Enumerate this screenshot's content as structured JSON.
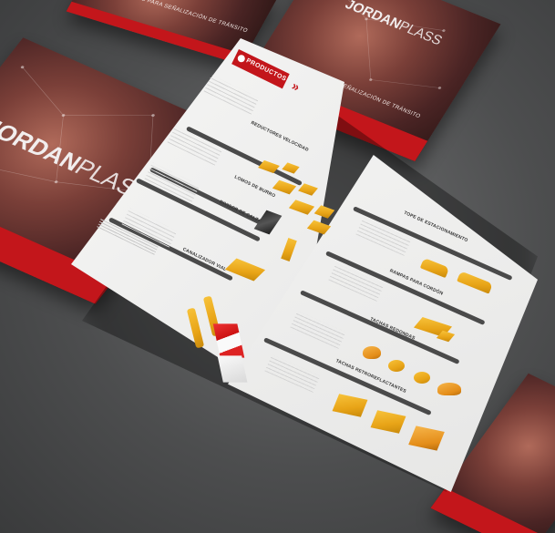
{
  "brand": {
    "logo_main": "JORDAN",
    "logo_sub": "PLASS",
    "cover_tagline": "PRODUCTOS PARA SEÑALIZACIÓN DE TRÁNSITO"
  },
  "open_brochure": {
    "header_tab": "PRODUCTOS",
    "left_sections": [
      "REDUCTORES VELOCIDAD",
      "LOMOS DE BURRO",
      "DIVISOR DE CALZADAS",
      "CANALIZADOR VIAL"
    ],
    "right_sections": [
      "TOPE DE ESTACIONAMIENTO",
      "RAMPAS PARA CORDÓN",
      "TACHAS REDONDAS",
      "TACHAS RETROREFLACTANTES"
    ]
  },
  "colors": {
    "brand_red": "#c3161b",
    "product_yellow": "#f2b526",
    "background_gray": "#565758"
  }
}
